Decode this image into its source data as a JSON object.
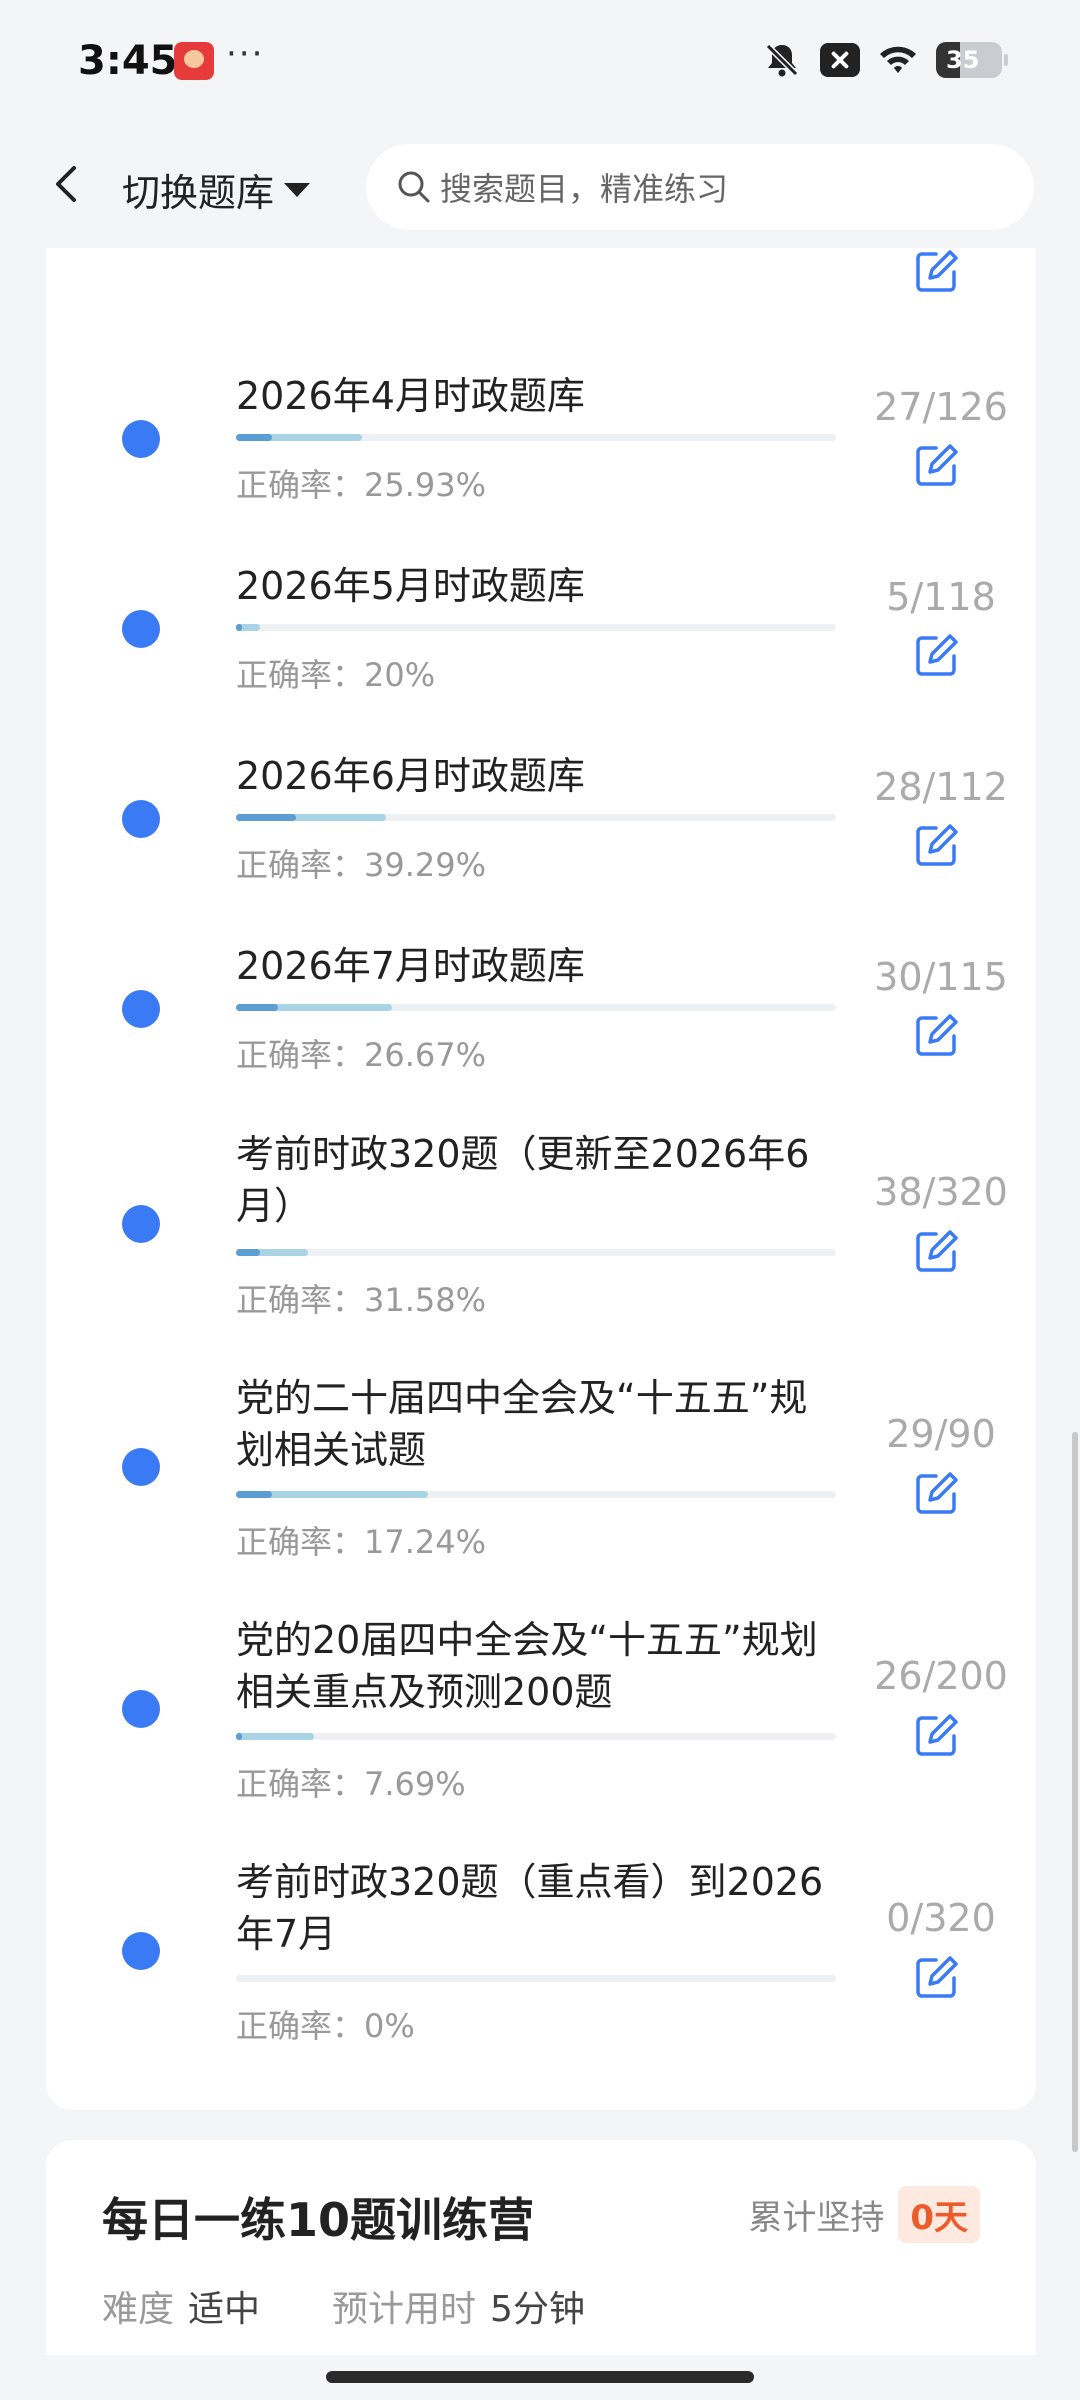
{
  "status_bar": {
    "time": "3:45",
    "dots": "···",
    "battery": "35"
  },
  "header": {
    "switch_label": "切换题库",
    "search_placeholder": "搜索题目，精准练习"
  },
  "items": [
    {
      "title": "",
      "accuracy": "正确率：0%",
      "count": "",
      "progress_dark": 0.005,
      "progress_light": 0.015
    },
    {
      "title": "2026年4月时政题库",
      "accuracy": "正确率：25.93%",
      "count": "27/126",
      "progress_dark": 0.06,
      "progress_light": 0.21
    },
    {
      "title": "2026年5月时政题库",
      "accuracy": "正确率：20%",
      "count": "5/118",
      "progress_dark": 0.01,
      "progress_light": 0.04
    },
    {
      "title": "2026年6月时政题库",
      "accuracy": "正确率：39.29%",
      "count": "28/112",
      "progress_dark": 0.1,
      "progress_light": 0.25
    },
    {
      "title": "2026年7月时政题库",
      "accuracy": "正确率：26.67%",
      "count": "30/115",
      "progress_dark": 0.07,
      "progress_light": 0.26
    },
    {
      "title": "考前时政320题（更新至2026年6月）",
      "accuracy": "正确率：31.58%",
      "count": "38/320",
      "progress_dark": 0.04,
      "progress_light": 0.12
    },
    {
      "title": "党的二十届四中全会及“十五五”规划相关试题",
      "accuracy": "正确率：17.24%",
      "count": "29/90",
      "progress_dark": 0.06,
      "progress_light": 0.32
    },
    {
      "title": "党的20届四中全会及“十五五”规划相关重点及预测200题",
      "accuracy": "正确率：7.69%",
      "count": "26/200",
      "progress_dark": 0.01,
      "progress_light": 0.13
    },
    {
      "title": "考前时政320题（重点看）到2026年7月",
      "accuracy": "正确率：0%",
      "count": "0/320",
      "progress_dark": 0,
      "progress_light": 0
    }
  ],
  "camp": {
    "title": "每日一练10题训练营",
    "streak_label": "累计坚持",
    "streak_value": "0天",
    "difficulty_label": "难度",
    "difficulty_value": "适中",
    "time_label": "预计用时",
    "time_value": "5分钟"
  },
  "colors": {
    "accent": "#3a7bf5",
    "streak": "#ee5b2a"
  }
}
